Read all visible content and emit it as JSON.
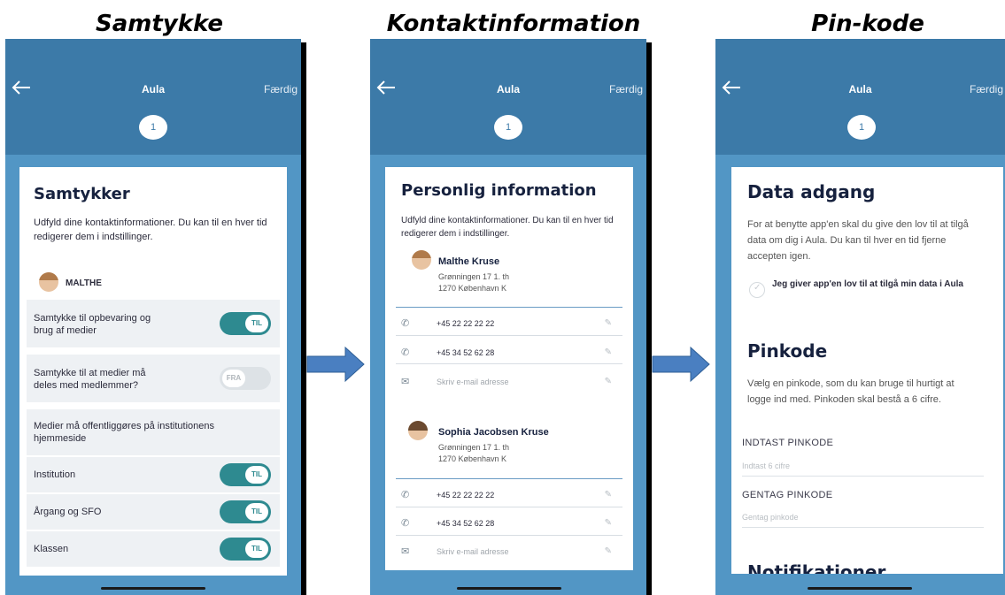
{
  "captions": [
    "Samtykke",
    "Kontaktinformation",
    "Pin-kode"
  ],
  "app": {
    "title": "Aula",
    "done_label": "Færdig",
    "step": "1",
    "back_icon": "arrow-left-icon"
  },
  "consent": {
    "title": "Samtykker",
    "description": "Udfyld dine kontaktinformationer. Du kan til en hver tid redigerer dem i indstillinger.",
    "child_name": "MALTHE",
    "items": [
      {
        "label": "Samtykke til opbevaring og brug af medier",
        "state": "TIL",
        "on": true
      },
      {
        "label": "Samtykke til at medier må deles med medlemmer?",
        "state": "FRA",
        "on": false
      },
      {
        "label": "Medier må offentliggøres på institutionens hjemmeside",
        "state": "",
        "on": null
      },
      {
        "label": "Institution",
        "state": "TIL",
        "on": true
      },
      {
        "label": "Årgang og SFO",
        "state": "TIL",
        "on": true
      },
      {
        "label": "Klassen",
        "state": "TIL",
        "on": true
      }
    ]
  },
  "contact": {
    "title": "Personlig information",
    "description": "Udfyld dine kontaktinformationer. Du kan til en hver tid redigerer dem i indstillinger.",
    "people": [
      {
        "name": "Malthe Kruse",
        "address1": "Grønningen 17 1. th",
        "address2": "1270 København K",
        "phone1": "+45 22 22 22 22",
        "phone2": "+45 34 52 62 28",
        "email_placeholder": "Skriv e-mail adresse"
      },
      {
        "name": "Sophia Jacobsen Kruse",
        "address1": "Grønningen 17 1. th",
        "address2": "1270 København K",
        "phone1": "+45 22 22 22 22",
        "phone2": "+45 34 52 62 28",
        "email_placeholder": "Skriv e-mail adresse"
      }
    ]
  },
  "pin": {
    "data_title": "Data adgang",
    "data_description": "For at benytte app'en skal du give den lov til at tilgå data om dig i Aula. Du kan til hver en tid fjerne accepten igen.",
    "consent_label": "Jeg giver app'en lov til at tilgå min data i Aula",
    "pin_title": "Pinkode",
    "pin_description": "Vælg en pinkode, som du kan bruge til hurtigt at logge ind med. Pinkoden skal bestå a 6 cifre.",
    "enter_label": "INDTAST PINKODE",
    "enter_placeholder": "Indtast 6 cifre",
    "repeat_label": "GENTAG PINKODE",
    "repeat_placeholder": "Gentag pinkode",
    "next_title": "Notifikationer"
  },
  "colors": {
    "appbar": "#3c7aa8",
    "background": "#5296c5",
    "toggle_on": "#2e8a90",
    "arrow": "#4a7fc1"
  }
}
